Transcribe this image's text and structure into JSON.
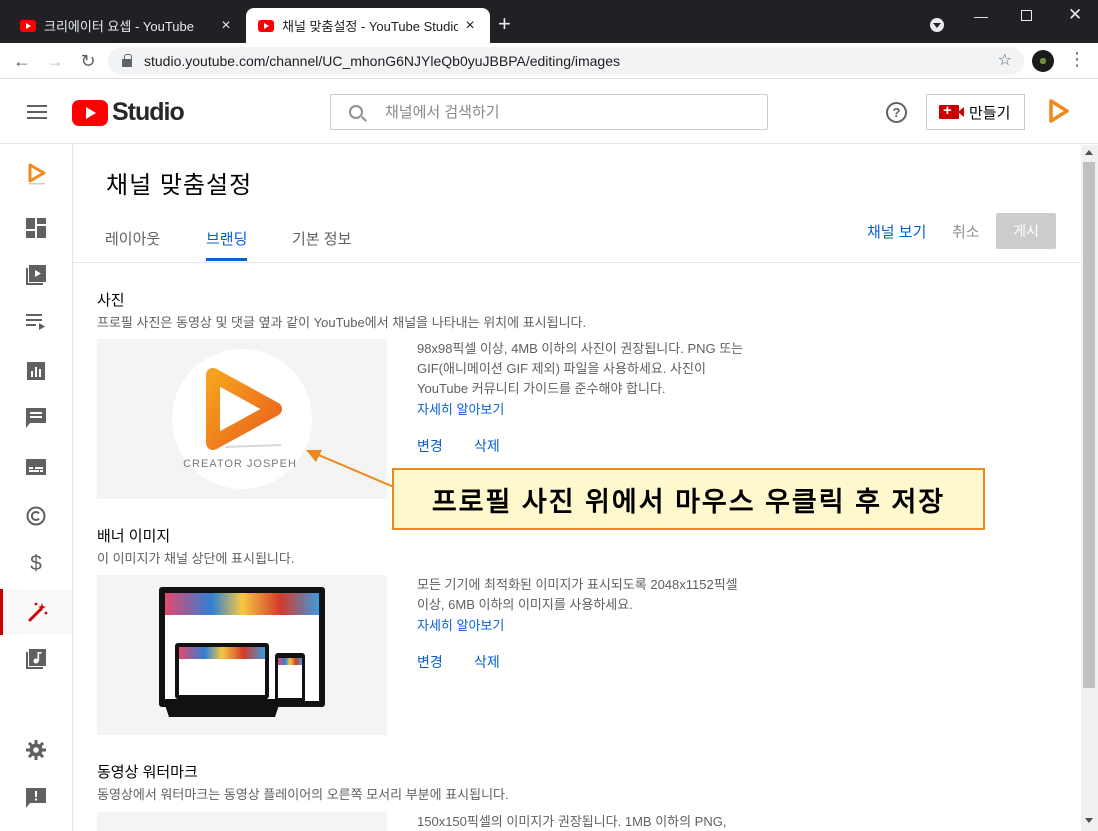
{
  "browser": {
    "tabs": [
      {
        "title": "크리에이터 요셉 - YouTube"
      },
      {
        "title": "채널 맞춤설정 - YouTube Studio"
      }
    ],
    "new_tab": "+",
    "url": "studio.youtube.com/channel/UC_mhonG6NJYleQb0yuJBBPA/editing/images"
  },
  "header": {
    "logo_text": "Studio",
    "search_placeholder": "채널에서 검색하기",
    "help": "?",
    "create_label": "만들기"
  },
  "page": {
    "title": "채널 맞춤설정",
    "tabs": [
      {
        "label": "레이아웃"
      },
      {
        "label": "브랜딩",
        "active": true
      },
      {
        "label": "기본 정보"
      }
    ],
    "view_channel": "채널 보기",
    "cancel": "취소",
    "publish": "게시"
  },
  "sections": {
    "photo": {
      "title": "사진",
      "desc": "프로필 사진은 동영상 및 댓글 옆과 같이 YouTube에서 채널을 나타내는 위치에 표시됩니다.",
      "info": "98x98픽셀 이상, 4MB 이하의 사진이 권장됩니다. PNG 또는 GIF(애니메이션 GIF 제외) 파일을 사용하세요. 사진이 YouTube 커뮤니티 가이드를 준수해야 합니다.",
      "learn_more": "자세히 알아보기",
      "change": "변경",
      "delete": "삭제",
      "logo_text": "CREATOR JOSPEH"
    },
    "banner": {
      "title": "배너 이미지",
      "desc": "이 이미지가 채널 상단에 표시됩니다.",
      "info": "모든 기기에 최적화된 이미지가 표시되도록 2048x1152픽셀 이상, 6MB 이하의 이미지를 사용하세요.",
      "learn_more": "자세히 알아보기",
      "change": "변경",
      "delete": "삭제"
    },
    "watermark": {
      "title": "동영상 워터마크",
      "desc": "동영상에서 워터마크는 동영상 플레이어의 오른쪽 모서리 부분에 표시됩니다.",
      "info": "150x150픽셀의 이미지가 권장됩니다. 1MB 이하의 PNG,"
    }
  },
  "callout": {
    "text": "프로필 사진 위에서 마우스 우클릭 후 저장"
  },
  "colors": {
    "accent": "#065fd4",
    "youtube_red": "#ff0000",
    "callout_border": "#ed8a1e",
    "callout_bg": "#fff8cd"
  }
}
